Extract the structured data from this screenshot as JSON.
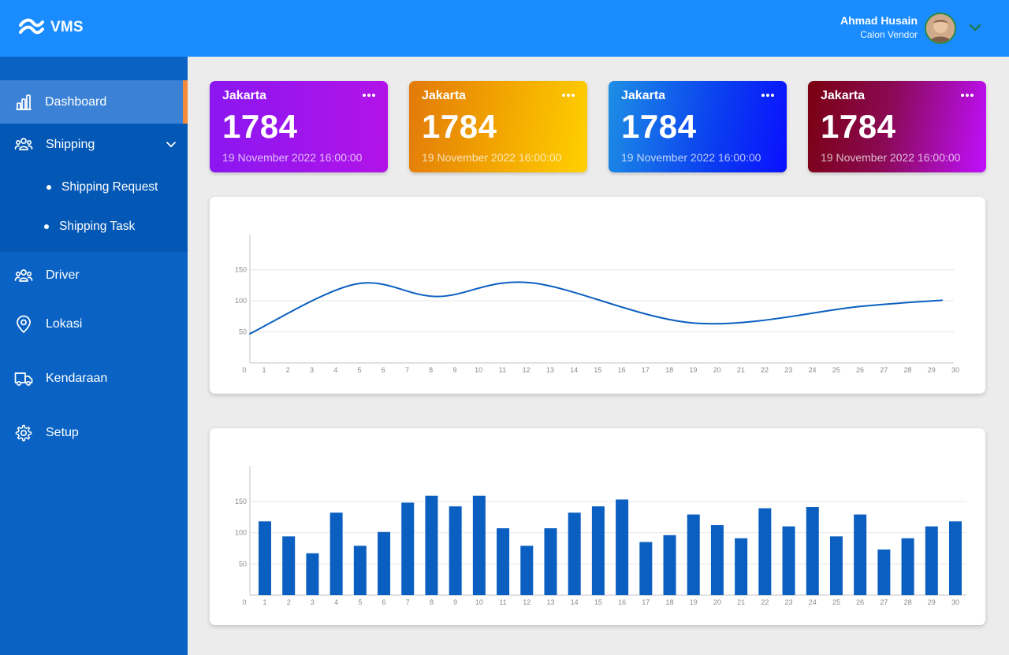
{
  "app": {
    "brand": "VMS"
  },
  "user": {
    "name": "Ahmad Husain",
    "role": "Calon Vendor"
  },
  "sidebar": {
    "items": [
      {
        "label": "Dashboard",
        "icon": "bar-chart-icon",
        "active": true
      },
      {
        "label": "Shipping",
        "icon": "users-group-icon",
        "expanded": true,
        "children": [
          {
            "label": "Shipping Request"
          },
          {
            "label": "Shipping Task"
          }
        ]
      },
      {
        "label": "Driver",
        "icon": "users-group-icon"
      },
      {
        "label": "Lokasi",
        "icon": "map-pin-icon"
      },
      {
        "label": "Kendaraan",
        "icon": "truck-icon"
      },
      {
        "label": "Setup",
        "icon": "gear-icon"
      }
    ]
  },
  "cards": [
    {
      "city": "Jakarta",
      "value": "1784",
      "date": "19 November 2022 16:00:00"
    },
    {
      "city": "Jakarta",
      "value": "1784",
      "date": "19 November 2022 16:00:00"
    },
    {
      "city": "Jakarta",
      "value": "1784",
      "date": "19 November 2022 16:00:00"
    },
    {
      "city": "Jakarta",
      "value": "1784",
      "date": "19 November 2022 16:00:00"
    }
  ],
  "colors": {
    "header": "#1b8cff",
    "sidebar": "#0a63c4",
    "series": "#0a5fc0",
    "accent": "#f58b3a"
  },
  "chart_data": [
    {
      "type": "line",
      "x": [
        0,
        4.5,
        8,
        12,
        19,
        26,
        29.5
      ],
      "values": [
        47,
        127,
        107,
        129,
        64,
        91,
        101
      ],
      "xlim": [
        0,
        30
      ],
      "ylim": [
        0,
        175
      ],
      "x_ticks": [
        "0",
        "1",
        "2",
        "3",
        "4",
        "5",
        "6",
        "7",
        "8",
        "9",
        "10",
        "11",
        "12",
        "13",
        "14",
        "15",
        "16",
        "17",
        "18",
        "19",
        "20",
        "21",
        "22",
        "23",
        "24",
        "25",
        "26",
        "27",
        "28",
        "29",
        "30"
      ],
      "y_ticks": [
        "50",
        "100",
        "150"
      ],
      "grid": true
    },
    {
      "type": "bar",
      "categories": [
        "1",
        "2",
        "3",
        "4",
        "5",
        "6",
        "7",
        "8",
        "9",
        "10",
        "11",
        "12",
        "13",
        "14",
        "15",
        "16",
        "17",
        "18",
        "19",
        "20",
        "21",
        "22",
        "23",
        "24",
        "25",
        "26",
        "27",
        "28",
        "29",
        "30"
      ],
      "values": [
        118,
        94,
        67,
        132,
        79,
        101,
        148,
        159,
        142,
        159,
        107,
        79,
        107,
        132,
        142,
        153,
        85,
        96,
        129,
        112,
        91,
        139,
        110,
        141,
        94,
        129,
        73,
        91,
        110,
        118
      ],
      "x_ticks": [
        "0",
        "1",
        "2",
        "3",
        "4",
        "5",
        "6",
        "7",
        "8",
        "9",
        "10",
        "11",
        "12",
        "13",
        "14",
        "15",
        "16",
        "17",
        "18",
        "19",
        "20",
        "21",
        "22",
        "23",
        "24",
        "25",
        "26",
        "27",
        "28",
        "29",
        "30"
      ],
      "y_ticks": [
        "50",
        "100",
        "150"
      ],
      "ylim": [
        0,
        175
      ],
      "grid": true
    }
  ]
}
